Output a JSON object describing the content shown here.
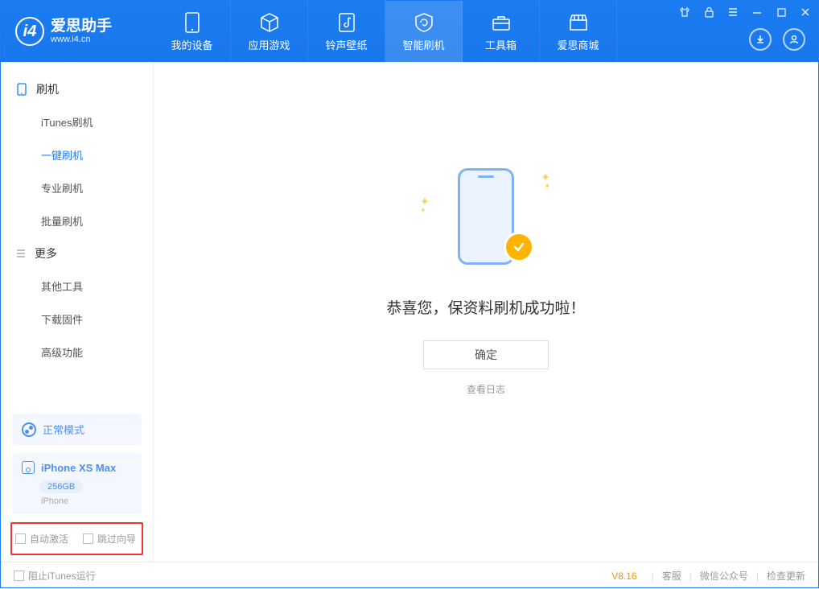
{
  "app": {
    "name_cn": "爱思助手",
    "name_en": "www.i4.cn"
  },
  "tabs": [
    {
      "label": "我的设备"
    },
    {
      "label": "应用游戏"
    },
    {
      "label": "铃声壁纸"
    },
    {
      "label": "智能刷机"
    },
    {
      "label": "工具箱"
    },
    {
      "label": "爱思商城"
    }
  ],
  "sidebar": {
    "group1": {
      "title": "刷机",
      "items": [
        "iTunes刷机",
        "一键刷机",
        "专业刷机",
        "批量刷机"
      ]
    },
    "group2": {
      "title": "更多",
      "items": [
        "其他工具",
        "下载固件",
        "高级功能"
      ]
    },
    "mode": "正常模式",
    "device": {
      "name": "iPhone XS Max",
      "capacity": "256GB",
      "type": "iPhone"
    },
    "chk_auto_activate": "自动激活",
    "chk_skip_wizard": "跳过向导"
  },
  "main": {
    "success_msg": "恭喜您，保资料刷机成功啦！",
    "ok_btn": "确定",
    "view_log": "查看日志"
  },
  "footer": {
    "block_itunes": "阻止iTunes运行",
    "version": "V8.16",
    "links": [
      "客服",
      "微信公众号",
      "检查更新"
    ]
  }
}
